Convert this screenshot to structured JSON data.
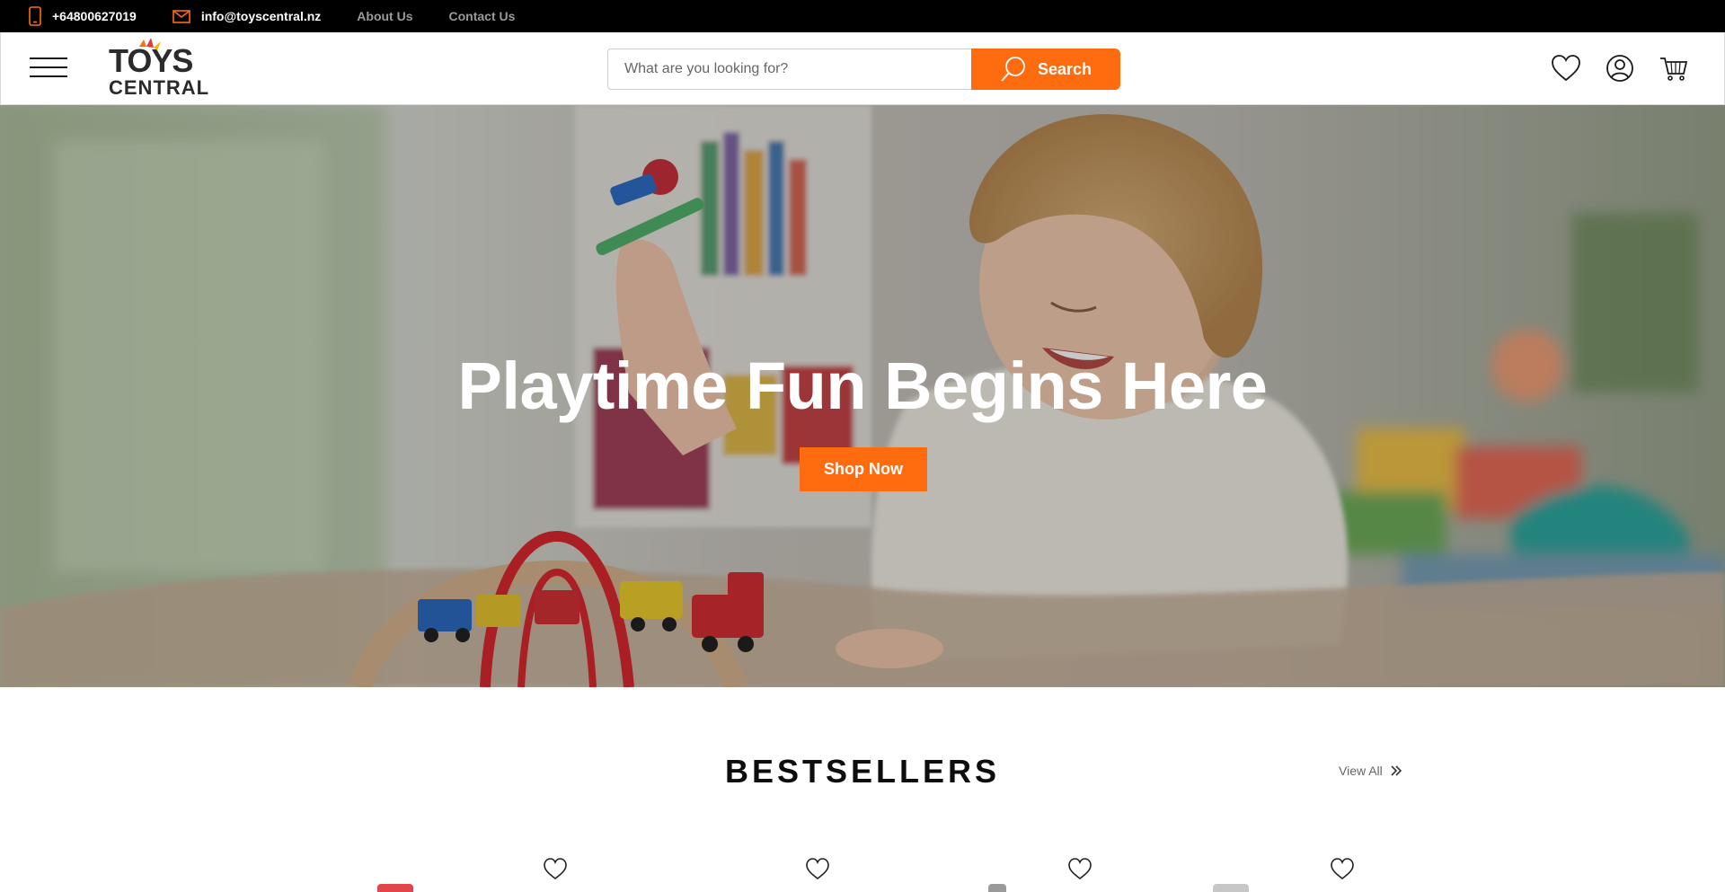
{
  "topbar": {
    "phone": "+64800627019",
    "email": "info@toyscentral.nz",
    "links": [
      "About Us",
      "Contact Us"
    ]
  },
  "header": {
    "logo_line1": "TOYS",
    "logo_line2": "CENTRAL",
    "search_placeholder": "What are you looking for?",
    "search_button": "Search",
    "icons": [
      "heart-icon",
      "user-icon",
      "cart-icon"
    ]
  },
  "hero": {
    "title": "Playtime Fun Begins Here",
    "cta": "Shop Now"
  },
  "bestsellers": {
    "title": "BESTSELLERS",
    "view_all": "View All"
  },
  "colors": {
    "accent": "#ff6b0f",
    "topbar_bg": "#000000",
    "text": "#111111"
  }
}
